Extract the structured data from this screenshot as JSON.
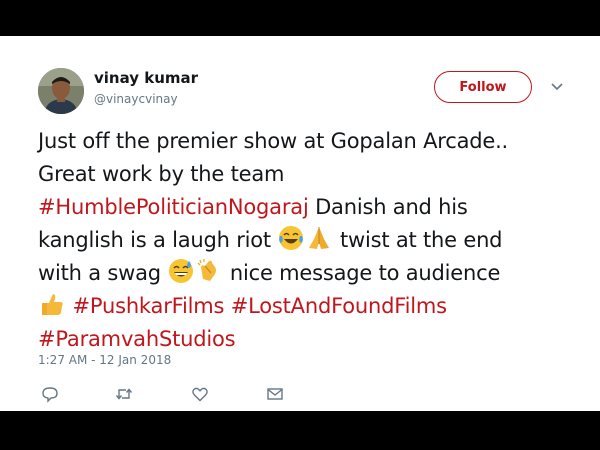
{
  "user": {
    "name": "vinay kumar",
    "handle": "@vinaycvinay"
  },
  "follow_label": "Follow",
  "tweet": {
    "line1": "Just off the premier show at Gopalan Arcade..",
    "line2": "Great work by the team",
    "line3_tag": "#HumblePoliticianNogaraj",
    "line3_rest": " Danish and his",
    "line4_text": "kanglish is a laugh riot",
    "line4_rest": " twist at the end",
    "line5_text": "with a swag",
    "line5_rest": " nice message to audience",
    "tag_pushkar": "#PushkarFilms",
    "tag_lostfound": "#LostAndFoundFilms",
    "tag_paramvah": "#ParamvahStudios"
  },
  "timestamp": "1:27 AM - 12 Jan 2018",
  "icons": {
    "reply": "reply-icon",
    "retweet": "retweet-icon",
    "like": "heart-icon",
    "dm": "envelope-icon",
    "more": "chevron-down-icon"
  },
  "colors": {
    "accent": "#c0161c",
    "text": "#14171a",
    "muted": "#657786"
  }
}
